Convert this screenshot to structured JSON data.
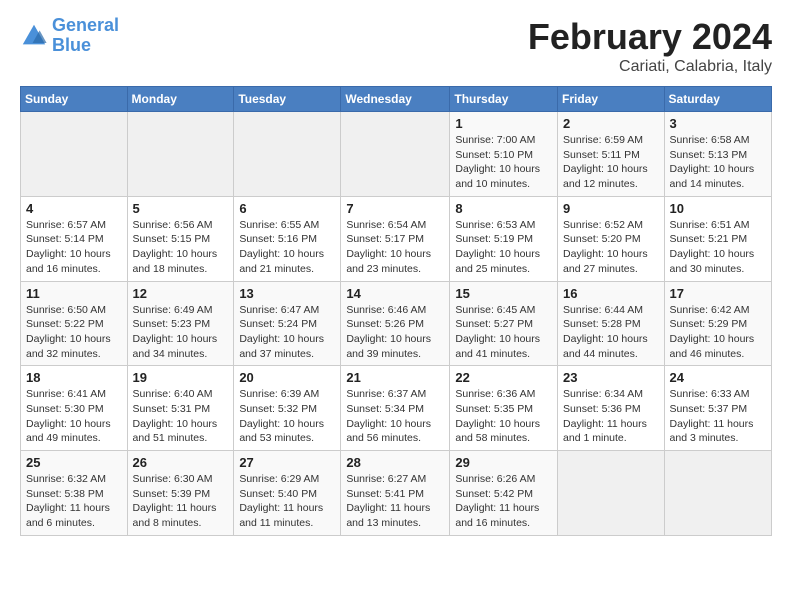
{
  "logo": {
    "line1": "General",
    "line2": "Blue"
  },
  "title": "February 2024",
  "subtitle": "Cariati, Calabria, Italy",
  "weekdays": [
    "Sunday",
    "Monday",
    "Tuesday",
    "Wednesday",
    "Thursday",
    "Friday",
    "Saturday"
  ],
  "weeks": [
    [
      {
        "day": "",
        "info": ""
      },
      {
        "day": "",
        "info": ""
      },
      {
        "day": "",
        "info": ""
      },
      {
        "day": "",
        "info": ""
      },
      {
        "day": "1",
        "info": "Sunrise: 7:00 AM\nSunset: 5:10 PM\nDaylight: 10 hours\nand 10 minutes."
      },
      {
        "day": "2",
        "info": "Sunrise: 6:59 AM\nSunset: 5:11 PM\nDaylight: 10 hours\nand 12 minutes."
      },
      {
        "day": "3",
        "info": "Sunrise: 6:58 AM\nSunset: 5:13 PM\nDaylight: 10 hours\nand 14 minutes."
      }
    ],
    [
      {
        "day": "4",
        "info": "Sunrise: 6:57 AM\nSunset: 5:14 PM\nDaylight: 10 hours\nand 16 minutes."
      },
      {
        "day": "5",
        "info": "Sunrise: 6:56 AM\nSunset: 5:15 PM\nDaylight: 10 hours\nand 18 minutes."
      },
      {
        "day": "6",
        "info": "Sunrise: 6:55 AM\nSunset: 5:16 PM\nDaylight: 10 hours\nand 21 minutes."
      },
      {
        "day": "7",
        "info": "Sunrise: 6:54 AM\nSunset: 5:17 PM\nDaylight: 10 hours\nand 23 minutes."
      },
      {
        "day": "8",
        "info": "Sunrise: 6:53 AM\nSunset: 5:19 PM\nDaylight: 10 hours\nand 25 minutes."
      },
      {
        "day": "9",
        "info": "Sunrise: 6:52 AM\nSunset: 5:20 PM\nDaylight: 10 hours\nand 27 minutes."
      },
      {
        "day": "10",
        "info": "Sunrise: 6:51 AM\nSunset: 5:21 PM\nDaylight: 10 hours\nand 30 minutes."
      }
    ],
    [
      {
        "day": "11",
        "info": "Sunrise: 6:50 AM\nSunset: 5:22 PM\nDaylight: 10 hours\nand 32 minutes."
      },
      {
        "day": "12",
        "info": "Sunrise: 6:49 AM\nSunset: 5:23 PM\nDaylight: 10 hours\nand 34 minutes."
      },
      {
        "day": "13",
        "info": "Sunrise: 6:47 AM\nSunset: 5:24 PM\nDaylight: 10 hours\nand 37 minutes."
      },
      {
        "day": "14",
        "info": "Sunrise: 6:46 AM\nSunset: 5:26 PM\nDaylight: 10 hours\nand 39 minutes."
      },
      {
        "day": "15",
        "info": "Sunrise: 6:45 AM\nSunset: 5:27 PM\nDaylight: 10 hours\nand 41 minutes."
      },
      {
        "day": "16",
        "info": "Sunrise: 6:44 AM\nSunset: 5:28 PM\nDaylight: 10 hours\nand 44 minutes."
      },
      {
        "day": "17",
        "info": "Sunrise: 6:42 AM\nSunset: 5:29 PM\nDaylight: 10 hours\nand 46 minutes."
      }
    ],
    [
      {
        "day": "18",
        "info": "Sunrise: 6:41 AM\nSunset: 5:30 PM\nDaylight: 10 hours\nand 49 minutes."
      },
      {
        "day": "19",
        "info": "Sunrise: 6:40 AM\nSunset: 5:31 PM\nDaylight: 10 hours\nand 51 minutes."
      },
      {
        "day": "20",
        "info": "Sunrise: 6:39 AM\nSunset: 5:32 PM\nDaylight: 10 hours\nand 53 minutes."
      },
      {
        "day": "21",
        "info": "Sunrise: 6:37 AM\nSunset: 5:34 PM\nDaylight: 10 hours\nand 56 minutes."
      },
      {
        "day": "22",
        "info": "Sunrise: 6:36 AM\nSunset: 5:35 PM\nDaylight: 10 hours\nand 58 minutes."
      },
      {
        "day": "23",
        "info": "Sunrise: 6:34 AM\nSunset: 5:36 PM\nDaylight: 11 hours\nand 1 minute."
      },
      {
        "day": "24",
        "info": "Sunrise: 6:33 AM\nSunset: 5:37 PM\nDaylight: 11 hours\nand 3 minutes."
      }
    ],
    [
      {
        "day": "25",
        "info": "Sunrise: 6:32 AM\nSunset: 5:38 PM\nDaylight: 11 hours\nand 6 minutes."
      },
      {
        "day": "26",
        "info": "Sunrise: 6:30 AM\nSunset: 5:39 PM\nDaylight: 11 hours\nand 8 minutes."
      },
      {
        "day": "27",
        "info": "Sunrise: 6:29 AM\nSunset: 5:40 PM\nDaylight: 11 hours\nand 11 minutes."
      },
      {
        "day": "28",
        "info": "Sunrise: 6:27 AM\nSunset: 5:41 PM\nDaylight: 11 hours\nand 13 minutes."
      },
      {
        "day": "29",
        "info": "Sunrise: 6:26 AM\nSunset: 5:42 PM\nDaylight: 11 hours\nand 16 minutes."
      },
      {
        "day": "",
        "info": ""
      },
      {
        "day": "",
        "info": ""
      }
    ]
  ]
}
